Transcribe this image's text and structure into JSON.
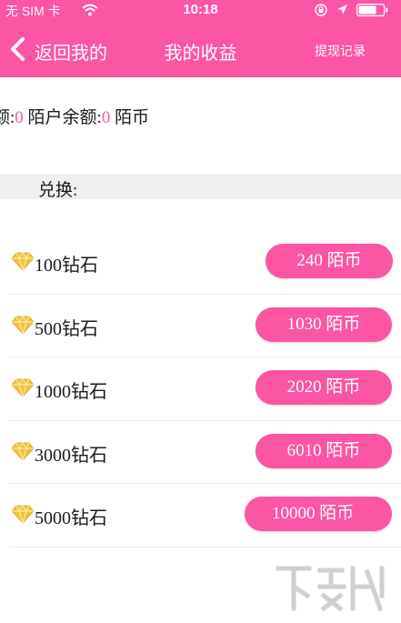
{
  "status_bar": {
    "carrier": "无 SIM 卡",
    "time": "10:18"
  },
  "nav": {
    "back_label": "返回我的",
    "title": "我的收益",
    "right_action": "提现记录"
  },
  "balance": {
    "left_label": "额:",
    "left_value": "0",
    "account_label": "陌户余额:",
    "account_value": "0",
    "unit": "陌币"
  },
  "section": {
    "label": "兑换:"
  },
  "exchange_items": [
    {
      "diamonds": "100钻石",
      "price": "240 陌币"
    },
    {
      "diamonds": "500钻石",
      "price": "1030 陌币"
    },
    {
      "diamonds": "1000钻石",
      "price": "2020 陌币"
    },
    {
      "diamonds": "3000钻石",
      "price": "6010 陌币"
    },
    {
      "diamonds": "5000钻石",
      "price": "10000 陌币"
    }
  ],
  "colors": {
    "brand_pink": "#fc55a3",
    "gem_gold": "#f1c33a",
    "section_band": "#efeff0"
  },
  "icons": {
    "back": "chevron-left-icon",
    "wifi": "wifi-icon",
    "orientation_lock": "lock-rotation-icon",
    "location": "location-arrow-icon",
    "battery": "battery-icon",
    "gem": "diamond-icon"
  }
}
